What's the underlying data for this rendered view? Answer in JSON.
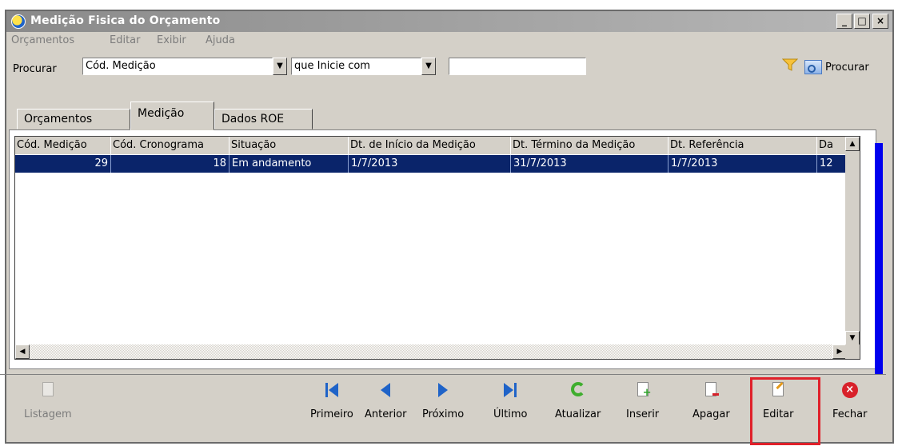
{
  "window": {
    "title": "Medição Fisica do Orçamento",
    "min": "_",
    "max": "□",
    "close": "×"
  },
  "menu": [
    "Orçamentos",
    "Editar",
    "Exibir",
    "Ajuda"
  ],
  "search": {
    "label": "Procurar",
    "field": "Cód. Medição",
    "operator": "que Inicie com",
    "value": "",
    "button_label": "Procurar"
  },
  "tabs": [
    "Orçamentos",
    "Medição",
    "Dados ROE"
  ],
  "active_tab": "Medição",
  "grid": {
    "columns": [
      "Cód. Medição",
      "Cód. Cronograma",
      "Situação",
      "Dt. de Início da Medição",
      "Dt. Término da Medição",
      "Dt. Referência",
      "Da"
    ],
    "rows": [
      [
        "29",
        "18",
        "Em andamento",
        "1/7/2013",
        "31/7/2013",
        "1/7/2013",
        "12"
      ]
    ]
  },
  "toolbar": {
    "listagem": "Listagem",
    "primeiro": "Primeiro",
    "anterior": "Anterior",
    "proximo": "Próximo",
    "ultimo": "Último",
    "atualizar": "Atualizar",
    "inserir": "Inserir",
    "apagar": "Apagar",
    "editar": "Editar",
    "fechar": "Fechar"
  },
  "colors": {
    "selection": "#0a246a",
    "highlight_box": "#e0202a",
    "accent": "#1f63c8"
  }
}
